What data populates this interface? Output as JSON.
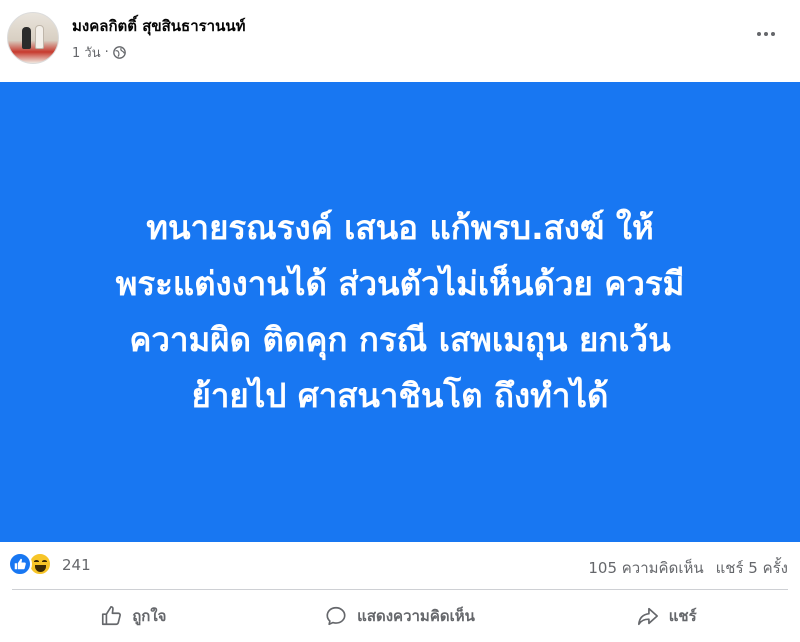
{
  "post": {
    "author": "มงคลกิตติ์ สุขสินธารานนท์",
    "time": "1 วัน",
    "privacy_icon": "globe-icon",
    "image_text_lines": [
      "ทนายรณรงค์ เสนอ แก้พรบ.สงฆ์ ให้",
      "พระแต่งงานได้ ส่วนตัวไม่เห็นด้วย ควรมี",
      "ความผิด ติดคุก กรณี เสพเมถุน ยกเว้น",
      "ย้ายไป ศาสนาชินโต ถึงทำได้"
    ],
    "image_background": "#1877f2"
  },
  "reactions": {
    "types": [
      "like",
      "haha"
    ],
    "count": "241",
    "comments": "105 ความคิดเห็น",
    "shares": "แชร์ 5 ครั้ง"
  },
  "actions": {
    "like_label": "ถูกใจ",
    "comment_label": "แสดงความคิดเห็น",
    "share_label": "แชร์"
  }
}
